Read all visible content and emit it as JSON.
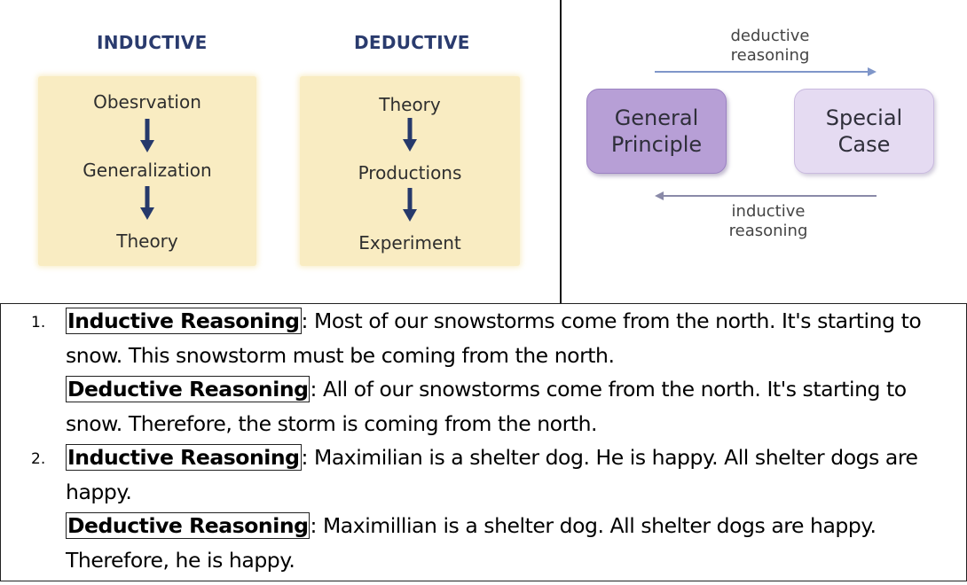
{
  "left_diagram": {
    "inductive": {
      "title": "INDUCTIVE",
      "steps": [
        "Obesrvation",
        "Generalization",
        "Theory"
      ]
    },
    "deductive": {
      "title": "DEDUCTIVE",
      "steps": [
        "Theory",
        "Productions",
        "Experiment"
      ]
    },
    "colors": {
      "title": "#2a3b6e",
      "panel": "#f9ecc2",
      "arrow": "#26396b"
    }
  },
  "right_diagram": {
    "top_label_line1": "deductive",
    "top_label_line2": "reasoning",
    "bottom_label_line1": "inductive",
    "bottom_label_line2": "reasoning",
    "box_left_line1": "General",
    "box_left_line2": "Principle",
    "box_right_line1": "Special",
    "box_right_line2": "Case",
    "colors": {
      "top_arrow": "#7f96c9",
      "bottom_arrow": "#8a8aa8",
      "box_left": "#b79fd6",
      "box_right": "#e5dbf2"
    }
  },
  "examples": [
    {
      "number": "1.",
      "paragraphs": [
        {
          "term": "Inductive Reasoning",
          "text": ": Most of our snowstorms come from the north. It's starting to snow. This snowstorm must be coming from the north."
        },
        {
          "term": "Deductive Reasoning",
          "text": ": All of our snowstorms come from the north. It's starting to snow. Therefore, the storm is coming from the north."
        }
      ]
    },
    {
      "number": "2.",
      "paragraphs": [
        {
          "term": "Inductive Reasoning",
          "text": ": Maximilian is a shelter dog. He is happy. All shelter dogs are happy."
        },
        {
          "term": "Deductive Reasoning",
          "text": ": Maximillian is a shelter dog. All shelter dogs are happy. Therefore, he is happy."
        }
      ]
    }
  ]
}
